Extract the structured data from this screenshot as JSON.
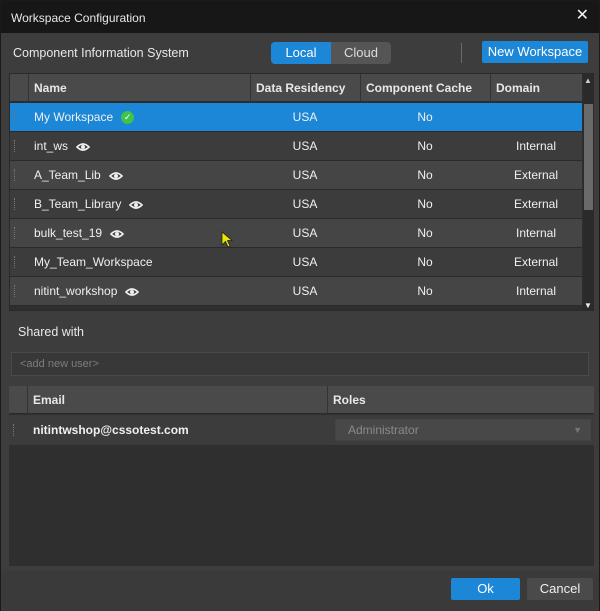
{
  "window": {
    "title": "Workspace Configuration",
    "close_glyph": "✕"
  },
  "system": {
    "label": "Component Information System",
    "toggle": [
      {
        "label": "Local",
        "active": true
      },
      {
        "label": "Cloud",
        "active": false
      }
    ],
    "new_workspace_label": "New Workspace"
  },
  "workspaces": {
    "columns": [
      "Name",
      "Data Residency",
      "Component Cache",
      "Domain"
    ],
    "rows": [
      {
        "name": "My Workspace",
        "icon": "check-icon",
        "residency": "USA",
        "cache": "No",
        "domain": "",
        "selected": true
      },
      {
        "name": "int_ws",
        "icon": "eye-icon",
        "residency": "USA",
        "cache": "No",
        "domain": "Internal"
      },
      {
        "name": "A_Team_Lib",
        "icon": "eye-icon",
        "residency": "USA",
        "cache": "No",
        "domain": "External"
      },
      {
        "name": "B_Team_Library",
        "icon": "eye-icon",
        "residency": "USA",
        "cache": "No",
        "domain": "External"
      },
      {
        "name": "bulk_test_19",
        "icon": "eye-icon",
        "residency": "USA",
        "cache": "No",
        "domain": "Internal"
      },
      {
        "name": "My_Team_Workspace",
        "icon": "",
        "residency": "USA",
        "cache": "No",
        "domain": "External"
      },
      {
        "name": "nitint_workshop",
        "icon": "eye-icon",
        "residency": "USA",
        "cache": "No",
        "domain": "Internal"
      }
    ]
  },
  "shared": {
    "label": "Shared with",
    "placeholder": "<add new user>",
    "columns": [
      "Email",
      "Roles"
    ],
    "users": [
      {
        "email": "nitintwshop@cssotest.com",
        "role": "Administrator"
      }
    ]
  },
  "footer": {
    "ok_label": "Ok",
    "cancel_label": "Cancel"
  },
  "colors": {
    "accent": "#1b87d6",
    "check": "#3fc34a",
    "background": "#3d3d3d",
    "titlebar": "#171717"
  }
}
